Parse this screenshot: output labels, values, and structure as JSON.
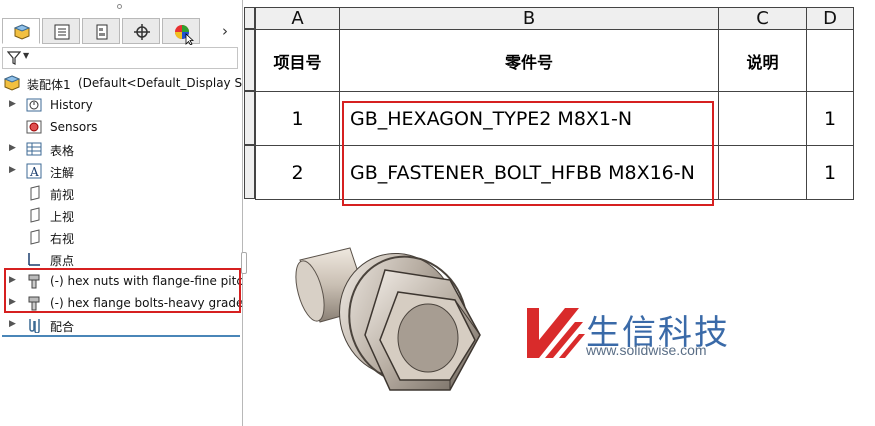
{
  "left_panel": {
    "root": {
      "label": "装配体1",
      "config": "(Default<Default_Display Sta"
    },
    "items": [
      {
        "label": "History",
        "icon": "history-icon",
        "expandable": true
      },
      {
        "label": "Sensors",
        "icon": "sensors-icon",
        "expandable": false
      },
      {
        "label": "表格",
        "icon": "table-icon",
        "expandable": true
      },
      {
        "label": "注解",
        "icon": "annotation-icon",
        "expandable": true
      },
      {
        "label": "前视",
        "icon": "plane-icon",
        "expandable": false
      },
      {
        "label": "上视",
        "icon": "plane-icon",
        "expandable": false
      },
      {
        "label": "右视",
        "icon": "plane-icon",
        "expandable": false
      },
      {
        "label": "原点",
        "icon": "origin-icon",
        "expandable": false
      },
      {
        "label": "(-) hex nuts with flange-fine pitch",
        "icon": "part-icon",
        "expandable": true
      },
      {
        "label": "(-) hex flange bolts-heavy grade",
        "icon": "part-icon",
        "expandable": true
      },
      {
        "label": "配合",
        "icon": "mates-icon",
        "expandable": true
      }
    ],
    "tabs": [
      "feature-manager-tab",
      "property-manager-tab",
      "configuration-manager-tab",
      "dim-xpert-tab",
      "display-manager-tab"
    ],
    "more_label": "›"
  },
  "bom": {
    "columns": [
      "A",
      "B",
      "C",
      "D"
    ],
    "headers": [
      "项目号",
      "零件号",
      "说明",
      ""
    ],
    "rows": [
      {
        "item": "1",
        "part": "GB_HEXAGON_TYPE2 M8X1-N",
        "desc": "",
        "qty": "1"
      },
      {
        "item": "2",
        "part": "GB_FASTENER_BOLT_HFBB M8X16-N",
        "desc": "",
        "qty": "1"
      }
    ]
  },
  "logo": {
    "name": "生信科技",
    "url": "www.solidwise.com"
  },
  "colors": {
    "highlight": "#d62020",
    "logo_red": "#d92b2b",
    "logo_blue": "#3a6aa8"
  }
}
